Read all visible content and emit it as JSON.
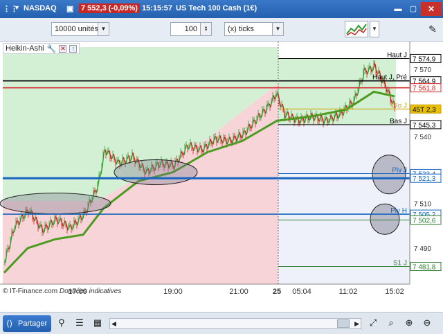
{
  "window": {
    "instrument": "NASDAQ",
    "price_badge": "7 552,3 (-0,09%)",
    "time": "15:15:57",
    "name": "US Tech 100 Cash (1€)"
  },
  "toolbar": {
    "units_select": "10000 unités",
    "ticks_value": "100",
    "ticks_select": "(x) ticks"
  },
  "indicator": {
    "label": "Heikin-Ashi"
  },
  "footer_note": {
    "copyright": "© IT-Finance.com",
    "disclaimer": "Données indicatives"
  },
  "chart_data": {
    "type": "line",
    "series": [
      {
        "name": "Heikin-Ashi"
      }
    ],
    "x_tick_labels": [
      "17:00",
      "19:00",
      "21:00",
      "25",
      "05:04",
      "11:02",
      "15:02"
    ],
    "y_tick_labels": [
      "7 570",
      "7 540",
      "7 510",
      "7 490"
    ],
    "ylim": [
      7477,
      7580
    ],
    "price_levels": [
      {
        "label": "Haut J",
        "value": 7574.9,
        "tag": "7 574,9",
        "tag_color": "#000000"
      },
      {
        "label": "Haut J, Pré",
        "value": 7564.9,
        "tag": "7 564,9",
        "tag_color": "#000000"
      },
      {
        "label": "",
        "value": 7561.8,
        "tag": "7 561,8",
        "tag_color": "#d32f2f"
      },
      {
        "label": "Clo J",
        "value": 7552.3,
        "tag": "45T 2,3",
        "tag_color": "#c8a000"
      },
      {
        "label": "Bas J",
        "value": 7545.3,
        "tag": "7 545,3",
        "tag_color": "#000000"
      },
      {
        "label": "Piv J",
        "value": 7523.4,
        "tag": "7 523,4",
        "tag_color": "#1565c0"
      },
      {
        "label": "",
        "value": 7521.3,
        "tag": "7 521,3",
        "tag_color": "#1565c0"
      },
      {
        "label": "Piv H",
        "value": 7505.2,
        "tag": "7 505,2",
        "tag_color": "#1565c0"
      },
      {
        "label": "",
        "value": 7502.6,
        "tag": "7 502,6",
        "tag_color": "#2e7d32"
      },
      {
        "label": "S1 J",
        "value": 7481.8,
        "tag": "7 481,8",
        "tag_color": "#2e7d32"
      }
    ],
    "ma_color": "#4c9a1f",
    "up_color": "#2e9b2e",
    "down_color": "#d32020"
  },
  "statusbar": {
    "share_label": "Partager"
  },
  "colors": {
    "titlebar": "#2e6ac0",
    "bull_zone": "#d4f0d4",
    "bear_zone": "#f6d4d8"
  }
}
